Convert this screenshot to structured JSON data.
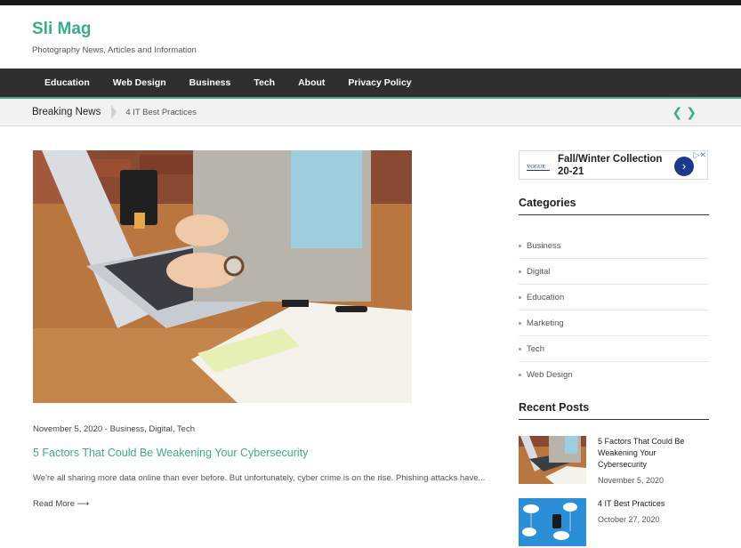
{
  "site": {
    "title": "Sli Mag",
    "tagline": "Photography News, Articles and Information"
  },
  "nav": {
    "items": [
      "Education",
      "Web Design",
      "Business",
      "Tech",
      "About",
      "Privacy Policy"
    ]
  },
  "breaking": {
    "label": "Breaking News",
    "text": "4 IT Best Practices",
    "prev_icon": "chevron-left-icon",
    "next_icon": "chevron-right-icon"
  },
  "post": {
    "meta": "November 5, 2020 - Business, Digital, Tech",
    "title": "5 Factors That Could Be Weakening Your Cybersecurity",
    "excerpt": "We're all sharing more data online than ever before. But unfortunately, cyber crime is on the rise. Phishing attacks have...",
    "read_more": "Read More ⟶"
  },
  "ad": {
    "brand": "VOGUE",
    "line1": "Fall/Winter Collection",
    "line2": "20-21",
    "button_icon": "chevron-right-icon",
    "close_icon": "close-icon"
  },
  "sidebar": {
    "categories_title": "Categories",
    "categories": [
      "Business",
      "Digital",
      "Education",
      "Marketing",
      "Tech",
      "Web Design"
    ],
    "recent_title": "Recent Posts",
    "recent": [
      {
        "title": "5 Factors That Could Be Weakening Your Cybersecurity",
        "date": "November 5, 2020"
      },
      {
        "title": "4 IT Best Practices",
        "date": "October 27, 2020"
      }
    ]
  },
  "colors": {
    "accent": "#3fa98c",
    "nav_bg": "#2f2f2f",
    "ad_button": "#1b3a8a"
  }
}
